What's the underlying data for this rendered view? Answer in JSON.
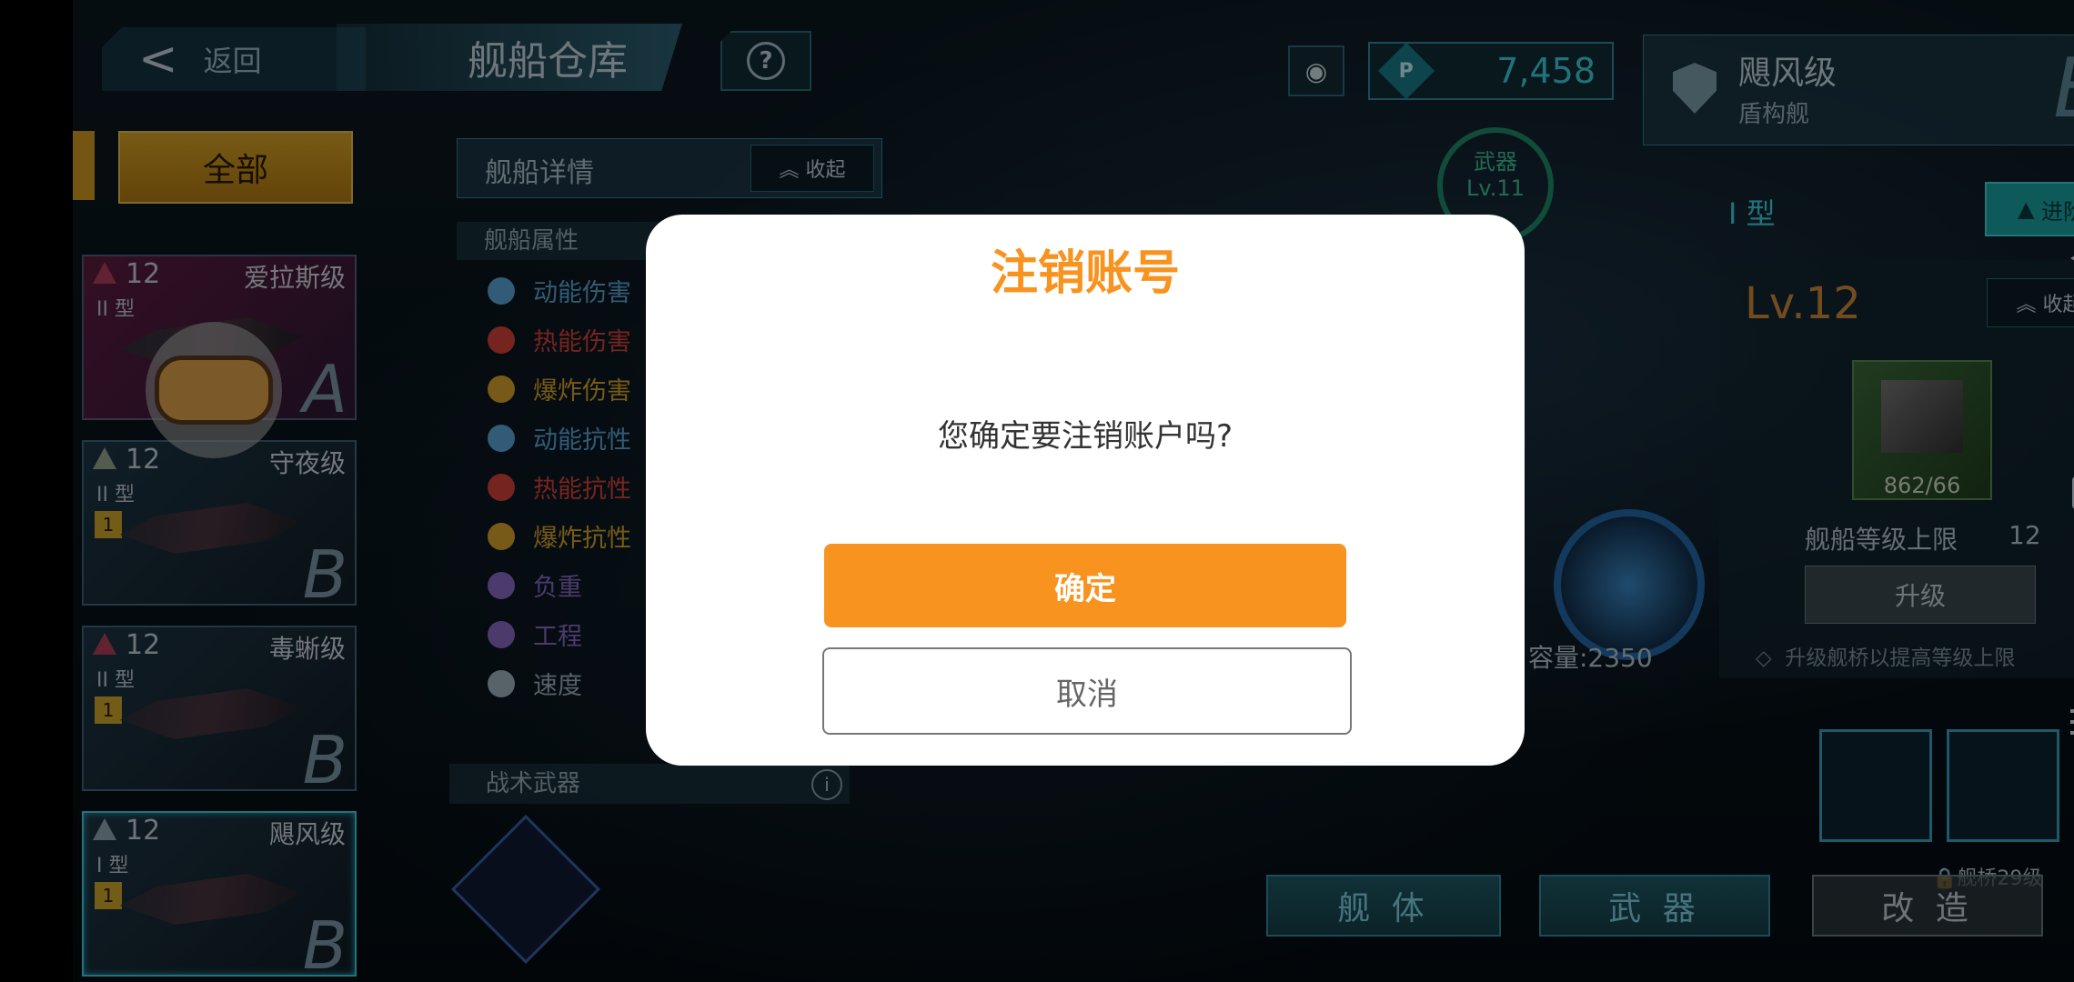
{
  "topbar": {
    "back_label": "返回",
    "title": "舰船仓库",
    "currency_value": "7,458",
    "currency_icon": "P"
  },
  "ship_header": {
    "name": "飓风级",
    "subtitle": "盾构舰",
    "grade": "B"
  },
  "filter": {
    "all_label": "全部"
  },
  "ship_cards": [
    {
      "level": "12",
      "class": "爱拉斯级",
      "type": "II 型",
      "grade": "A"
    },
    {
      "level": "12",
      "class": "守夜级",
      "type": "II 型",
      "star": "1",
      "grade": "B"
    },
    {
      "level": "12",
      "class": "毒蜥级",
      "type": "II 型",
      "star": "1",
      "grade": "B"
    },
    {
      "level": "12",
      "class": "飓风级",
      "type": "I 型",
      "star": "1",
      "grade": "B"
    }
  ],
  "details": {
    "title": "舰船详情",
    "collapse_label": "收起",
    "attributes_header": "舰船属性",
    "attributes": [
      {
        "label": "动能伤害",
        "color": "#5aa7d8"
      },
      {
        "label": "热能伤害",
        "color": "#d8433a"
      },
      {
        "label": "爆炸伤害",
        "color": "#d9a52a"
      },
      {
        "label": "动能抗性",
        "color": "#5aa7d8"
      },
      {
        "label": "热能抗性",
        "color": "#d8433a"
      },
      {
        "label": "爆炸抗性",
        "color": "#d9a52a"
      },
      {
        "label": "负重",
        "color": "#8a6bc6"
      },
      {
        "label": "工程",
        "color": "#8a6bc6"
      },
      {
        "label": "速度",
        "color": "#9fb3bf"
      }
    ],
    "tactical_weapon": "战术武器"
  },
  "center": {
    "weapon_ring_label": "武器",
    "weapon_ring_level": "Lv.11",
    "capacity": "容量:2350"
  },
  "right_panel": {
    "type_label": "I 型",
    "advance_label": "进阶",
    "level": "Lv.12",
    "collapse_label": "收起",
    "item_count": "862/66",
    "level_cap_label": "舰船等级上限",
    "level_cap_value": "12",
    "upgrade_label": "升级",
    "hint": "升级舰桥以提高等级上限",
    "bridge_req": "舰桥29级"
  },
  "bottom_tabs": [
    "舰 体",
    "武 器",
    "改 造"
  ],
  "dialog": {
    "title": "注销账号",
    "message": "您确定要注销账户吗?",
    "confirm_label": "确定",
    "cancel_label": "取消"
  }
}
